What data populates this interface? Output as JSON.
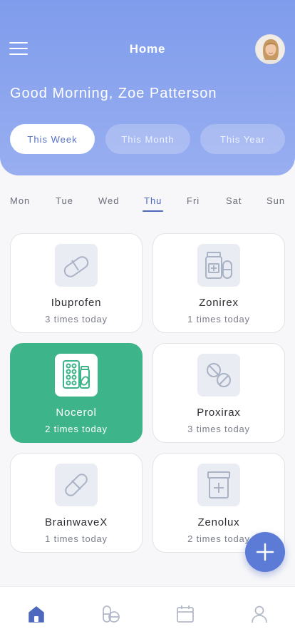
{
  "header": {
    "title": "Home",
    "greeting": "Good Morning, Zoe Patterson"
  },
  "period_tabs": [
    {
      "label": "This Week",
      "active": true
    },
    {
      "label": "This Month",
      "active": false
    },
    {
      "label": "This Year",
      "active": false
    }
  ],
  "days": [
    {
      "label": "Mon"
    },
    {
      "label": "Tue"
    },
    {
      "label": "Wed"
    },
    {
      "label": "Thu",
      "active": true
    },
    {
      "label": "Fri"
    },
    {
      "label": "Sat"
    },
    {
      "label": "Sun"
    }
  ],
  "medications": [
    {
      "name": "Ibuprofen",
      "frequency": "3 times today",
      "icon": "capsule-icon",
      "active": false
    },
    {
      "name": "Zonirex",
      "frequency": "1 times today",
      "icon": "pill-bottle-icon",
      "active": false
    },
    {
      "name": "Nocerol",
      "frequency": "2 times today",
      "icon": "blister-pack-icon",
      "active": true
    },
    {
      "name": "Proxirax",
      "frequency": "3 times today",
      "icon": "tablets-icon",
      "active": false
    },
    {
      "name": "BrainwaveX",
      "frequency": "1 times today",
      "icon": "pill-icon",
      "active": false
    },
    {
      "name": "Zenolux",
      "frequency": "2 times today",
      "icon": "medicine-box-icon",
      "active": false
    }
  ],
  "bottom_nav": [
    {
      "icon": "home-icon",
      "active": true
    },
    {
      "icon": "pills-icon",
      "active": false
    },
    {
      "icon": "calendar-icon",
      "active": false
    },
    {
      "icon": "profile-icon",
      "active": false
    }
  ],
  "colors": {
    "header_gradient_top": "#7f9cec",
    "header_gradient_bottom": "#98aef0",
    "accent": "#4e68bd",
    "active_card": "#3db489",
    "fab": "#5b7bd6",
    "icon_gray": "#aab2c5"
  }
}
